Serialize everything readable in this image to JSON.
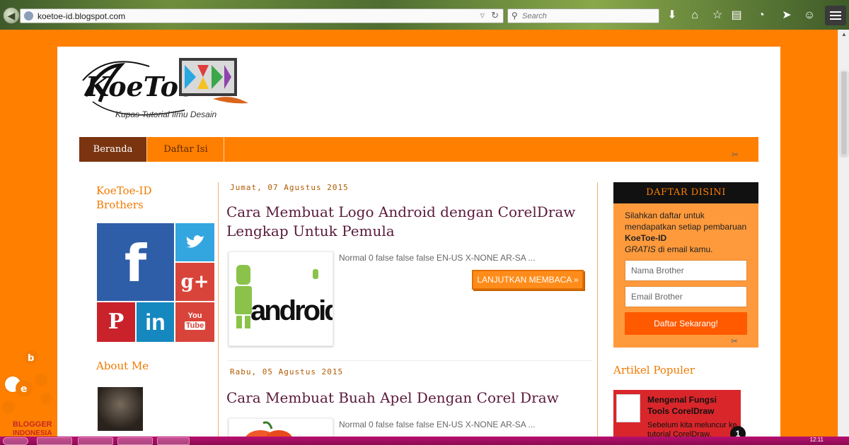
{
  "browser": {
    "url": "koetoe-id.blogspot.com",
    "search_placeholder": "Search",
    "icons": [
      "back-icon",
      "download-icon",
      "home-icon",
      "bookmark-star-icon",
      "reading-list-icon",
      "addon-icon",
      "send-icon",
      "smiley-icon",
      "menu-icon"
    ]
  },
  "site": {
    "logo_text": "KoeToe",
    "tagline": "Kupas Tutorial Ilmu Desain",
    "accent_color": "#ff7f00"
  },
  "nav": {
    "items": [
      {
        "label": "Beranda",
        "active": true
      },
      {
        "label": "Daftar Isi",
        "active": false
      }
    ]
  },
  "left_sidebar": {
    "brothers_title": "KoeToe-ID Brothers",
    "social": [
      {
        "name": "facebook",
        "glyph": "f",
        "color": "#2f5ea8"
      },
      {
        "name": "twitter",
        "glyph": "🐦",
        "color": "#33a6e0"
      },
      {
        "name": "google-plus",
        "glyph": "g+",
        "color": "#d9443a"
      },
      {
        "name": "pinterest",
        "glyph": "P",
        "color": "#c9222b"
      },
      {
        "name": "linkedin",
        "glyph": "in",
        "color": "#1588bf"
      },
      {
        "name": "youtube",
        "glyph": "You Tube",
        "color": "#d9443a"
      }
    ],
    "about_title": "About Me"
  },
  "posts": [
    {
      "date": "Jumat, 07 Agustus 2015",
      "title": "Cara Membuat Logo Android dengan CorelDraw Lengkap Untuk Pemula",
      "thumb_word": "android",
      "snippet": "Normal 0 false false false EN-US X-NONE AR-SA ...",
      "read_more": "LANJUTKAN MEMBACA »"
    },
    {
      "date": "Rabu, 05 Agustus 2015",
      "title": "Cara Membuat Buah Apel Dengan Corel Draw",
      "snippet": "Normal 0 false false false EN-US X-NONE AR-SA ..."
    }
  ],
  "right_sidebar": {
    "daftar_title": "DAFTAR DISINI",
    "daftar_text_1": "Silahkan daftar untuk mendapatkan setiap pembaruan ",
    "daftar_brand": "KoeToe-ID",
    "daftar_gratis": "GRATIS",
    "daftar_text_2": " di email kamu.",
    "name_placeholder": "Nama Brother",
    "email_placeholder": "Email Brother",
    "submit_label": "Daftar Sekarang!",
    "popular_title": "Artikel Populer",
    "popular_post_title": "Mengenal Fungsi Tools CorelDraw",
    "popular_post_snippet": "Sebelum kita meluncur ke tutorial CorelDraw, alangkah"
  },
  "badge": {
    "line1": "BLOGGER",
    "line2": "INDONESIA"
  },
  "notification_count": "1",
  "taskbar": {
    "clock": "12:11"
  }
}
